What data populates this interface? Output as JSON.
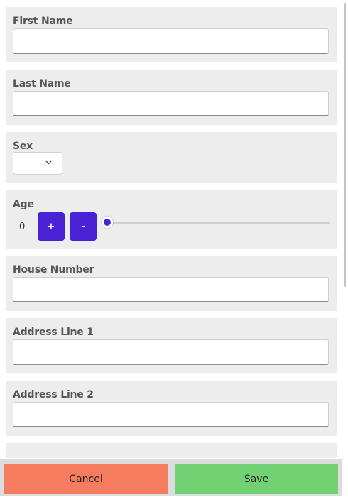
{
  "form": {
    "fields": {
      "first_name": {
        "label": "First Name",
        "value": ""
      },
      "last_name": {
        "label": "Last Name",
        "value": ""
      },
      "sex": {
        "label": "Sex",
        "value": ""
      },
      "age": {
        "label": "Age",
        "value": "0",
        "increment_label": "+",
        "decrement_label": "-",
        "slider_level": 0
      },
      "house_number": {
        "label": "House Number",
        "value": ""
      },
      "address_line_1": {
        "label": "Address Line 1",
        "value": ""
      },
      "address_line_2": {
        "label": "Address Line 2",
        "value": ""
      }
    }
  },
  "footer": {
    "cancel_label": "Cancel",
    "save_label": "Save"
  },
  "colors": {
    "accent": "#4a22d6",
    "cancel": "#f67c60",
    "save": "#72d173",
    "panel": "#ededed"
  },
  "icons": {
    "sex_dropdown": "chevron-down-icon"
  }
}
